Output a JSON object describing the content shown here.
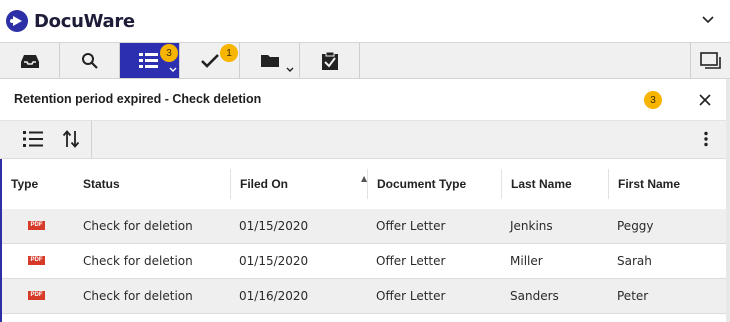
{
  "app": {
    "name": "DocuWare"
  },
  "toolbar": {
    "tasks_badge": "3",
    "check_badge": "1"
  },
  "header": {
    "title": "Retention period expired - Check deletion",
    "count": "3"
  },
  "table": {
    "columns": [
      "Type",
      "Status",
      "Filed On",
      "Document Type",
      "Last Name",
      "First Name"
    ],
    "rows": [
      {
        "type": "PDF",
        "status": "Check for deletion",
        "filed_on": "01/15/2020",
        "document_type": "Offer Letter",
        "last_name": "Jenkins",
        "first_name": "Peggy"
      },
      {
        "type": "PDF",
        "status": "Check for deletion",
        "filed_on": "01/15/2020",
        "document_type": "Offer Letter",
        "last_name": "Miller",
        "first_name": "Sarah"
      },
      {
        "type": "PDF",
        "status": "Check for deletion",
        "filed_on": "01/16/2020",
        "document_type": "Offer Letter",
        "last_name": "Sanders",
        "first_name": "Peter"
      }
    ]
  },
  "colors": {
    "accent": "#2c2fb0",
    "badge": "#f7b500",
    "pdf": "#d63b2a"
  },
  "icons": [
    "logo-icon",
    "chevron-down-icon",
    "inbox-icon",
    "search-icon",
    "task-list-icon",
    "checkmark-icon",
    "folder-icon",
    "clipboard-check-icon",
    "window-icon",
    "close-icon",
    "list-view-icon",
    "sort-icon",
    "more-vertical-icon",
    "pdf-icon"
  ]
}
